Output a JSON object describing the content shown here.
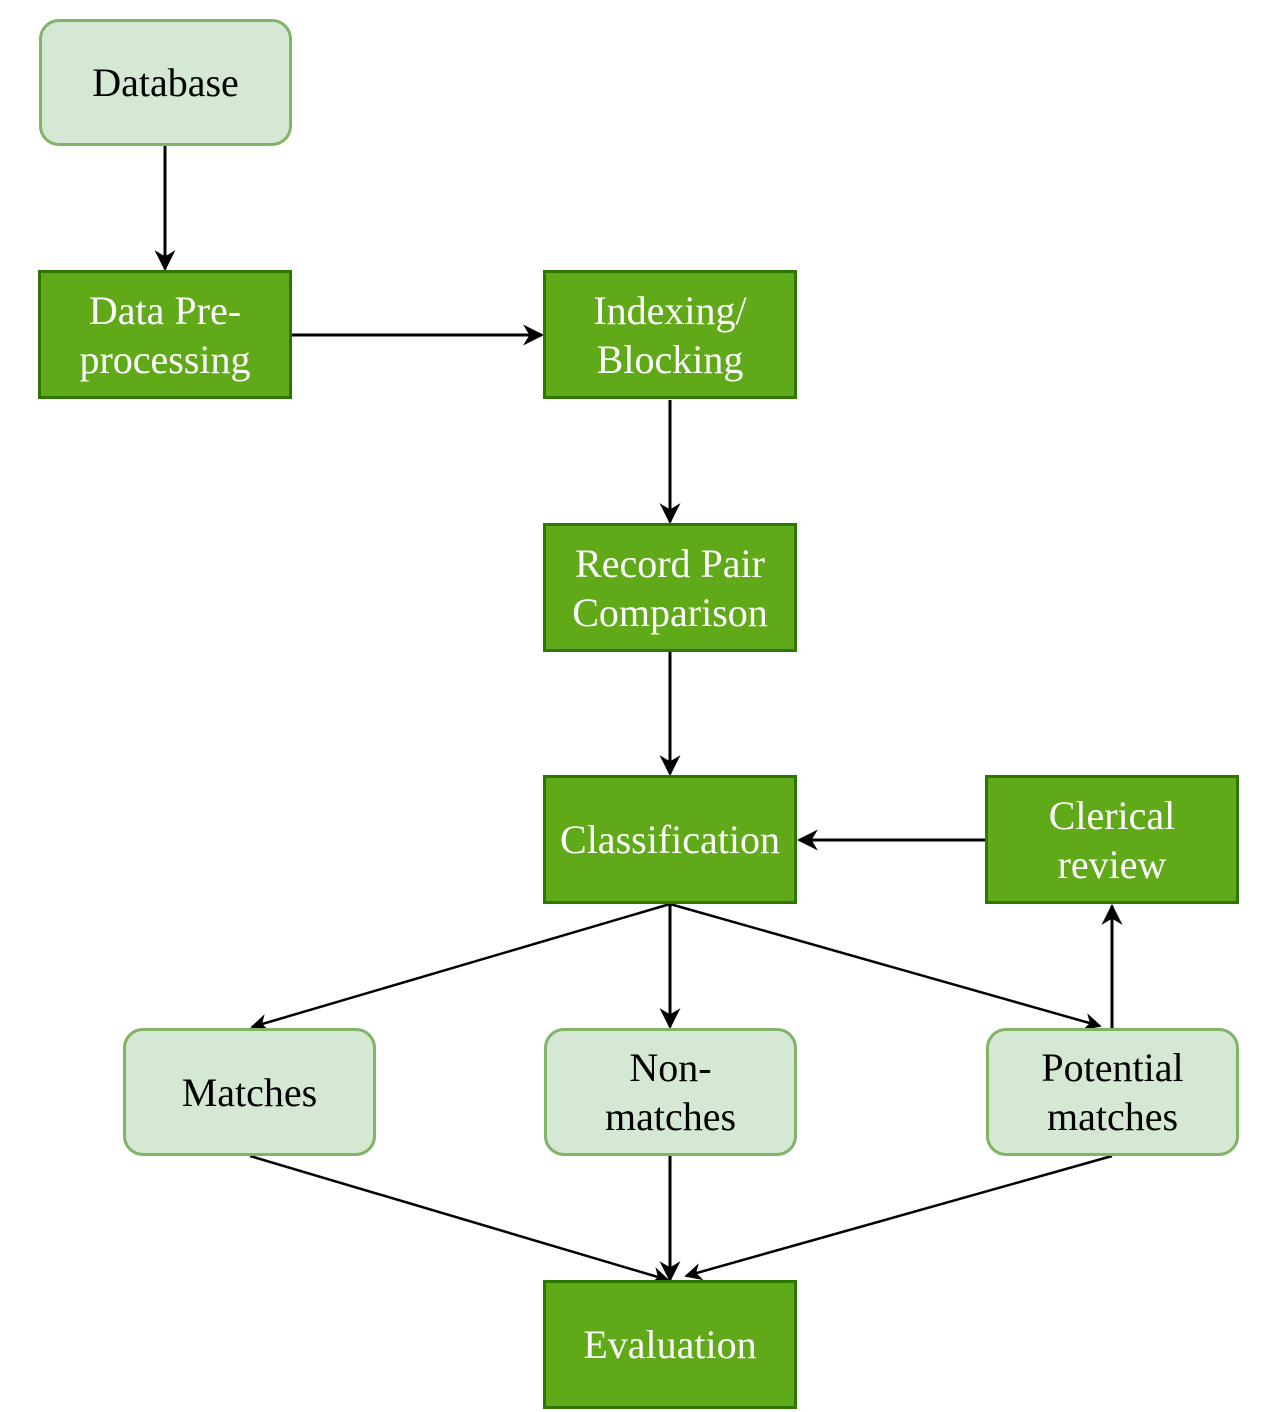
{
  "diagram": {
    "type": "flowchart",
    "colors": {
      "process_fill": "#60a918",
      "process_stroke": "#2d7600",
      "outcome_fill": "#d5e8d4",
      "outcome_stroke": "#82b366",
      "edge": "#000000"
    },
    "nodes": [
      {
        "id": "database",
        "label": "Database",
        "style": "outcome"
      },
      {
        "id": "preprocessing",
        "label": "Data Pre-\nprocessing",
        "style": "process"
      },
      {
        "id": "indexing",
        "label": "Indexing/\nBlocking",
        "style": "process"
      },
      {
        "id": "comparison",
        "label": "Record Pair\nComparison",
        "style": "process"
      },
      {
        "id": "classification",
        "label": "Classification",
        "style": "process"
      },
      {
        "id": "clerical",
        "label": "Clerical\nreview",
        "style": "process"
      },
      {
        "id": "matches",
        "label": "Matches",
        "style": "outcome"
      },
      {
        "id": "nonmatches",
        "label": "Non-\nmatches",
        "style": "outcome"
      },
      {
        "id": "potential",
        "label": "Potential\nmatches",
        "style": "outcome"
      },
      {
        "id": "evaluation",
        "label": "Evaluation",
        "style": "process"
      }
    ],
    "edges": [
      {
        "from": "database",
        "to": "preprocessing"
      },
      {
        "from": "preprocessing",
        "to": "indexing"
      },
      {
        "from": "indexing",
        "to": "comparison"
      },
      {
        "from": "comparison",
        "to": "classification"
      },
      {
        "from": "clerical",
        "to": "classification"
      },
      {
        "from": "classification",
        "to": "matches"
      },
      {
        "from": "classification",
        "to": "nonmatches"
      },
      {
        "from": "classification",
        "to": "potential"
      },
      {
        "from": "potential",
        "to": "clerical"
      },
      {
        "from": "matches",
        "to": "evaluation"
      },
      {
        "from": "nonmatches",
        "to": "evaluation"
      },
      {
        "from": "potential",
        "to": "evaluation"
      }
    ]
  }
}
